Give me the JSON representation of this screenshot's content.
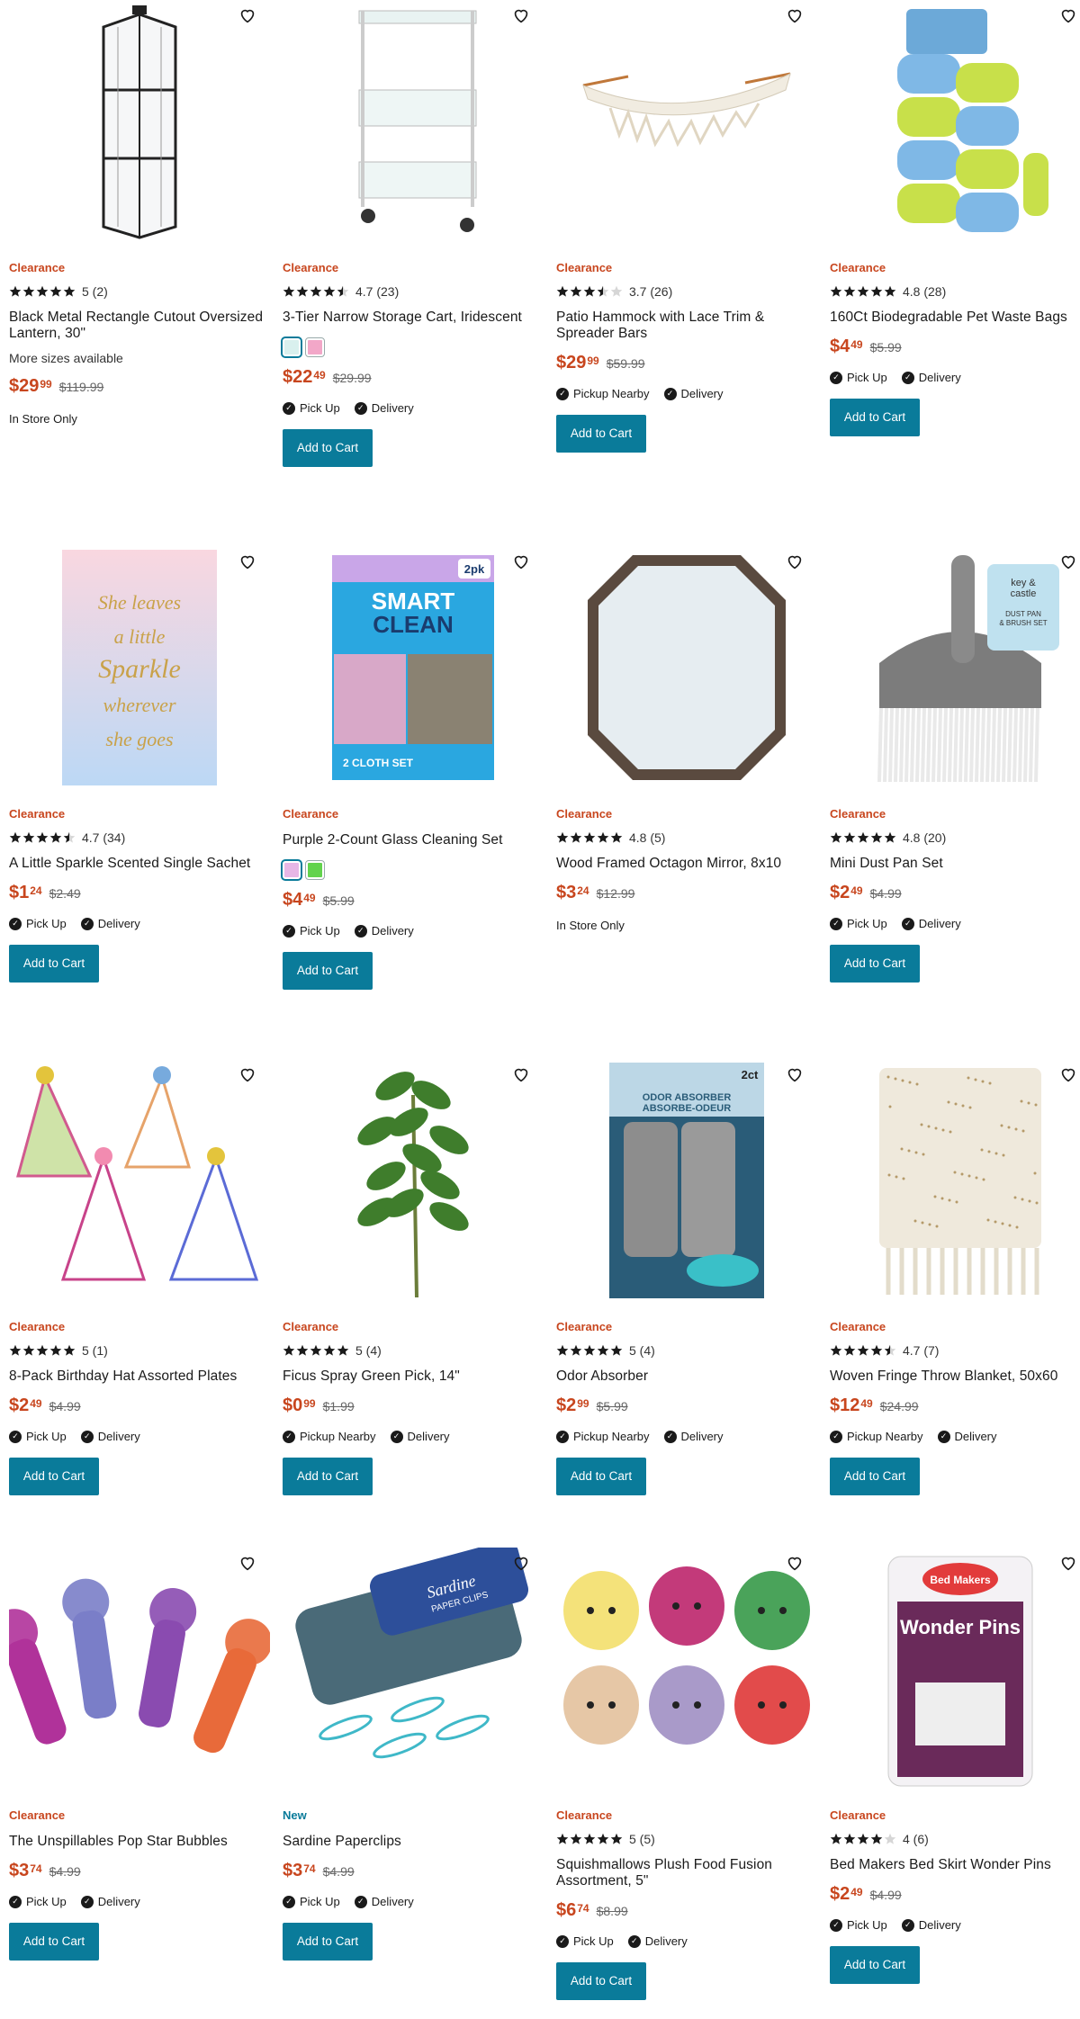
{
  "colors": {
    "clearance": "#c8461e",
    "new": "#0a7b9a",
    "button": "#0a7b9a",
    "text": "#1a1a1a"
  },
  "add_to_cart_label": "Add to Cart",
  "products": [
    {
      "badge": "Clearance",
      "rating": "5 (2)",
      "stars": 5,
      "title": "Black Metal Rectangle Cutout Oversized Lantern, 30\"",
      "more": "More sizes available",
      "price_dollars": "$29",
      "price_cents": "99",
      "was": "$119.99",
      "instore": "In Store Only",
      "image": "lantern"
    },
    {
      "badge": "Clearance",
      "rating": "4.7 (23)",
      "stars": 4.5,
      "title": "3-Tier Narrow Storage Cart, Iridescent",
      "swatches": [
        "#d9f0ee",
        "#f2a7c8"
      ],
      "price_dollars": "$22",
      "price_cents": "49",
      "was": "$29.99",
      "fulfill": [
        "Pick Up",
        "Delivery"
      ],
      "image": "cart"
    },
    {
      "badge": "Clearance",
      "rating": "3.7 (26)",
      "stars": 3.5,
      "title": "Patio Hammock with Lace Trim & Spreader Bars",
      "price_dollars": "$29",
      "price_cents": "99",
      "was": "$59.99",
      "fulfill": [
        "Pickup Nearby",
        "Delivery"
      ],
      "image": "hammock"
    },
    {
      "badge": "Clearance",
      "rating": "4.8 (28)",
      "stars": 5,
      "title": "160Ct Biodegradable Pet Waste Bags",
      "price_dollars": "$4",
      "price_cents": "49",
      "was": "$5.99",
      "fulfill": [
        "Pick Up",
        "Delivery"
      ],
      "image": "bags"
    },
    {
      "badge": "Clearance",
      "rating": "4.7 (34)",
      "stars": 4.5,
      "title": "A Little Sparkle Scented Single Sachet",
      "price_dollars": "$1",
      "price_cents": "24",
      "was": "$2.49",
      "fulfill": [
        "Pick Up",
        "Delivery"
      ],
      "image": "sachet",
      "image_text": [
        "She leaves",
        "a little",
        "Sparkle",
        "wherever",
        "she goes"
      ]
    },
    {
      "badge": "Clearance",
      "title": "Purple 2-Count Glass Cleaning Set",
      "swatches": [
        "#e7b7e6",
        "#62d34d"
      ],
      "price_dollars": "$4",
      "price_cents": "49",
      "was": "$5.99",
      "fulfill": [
        "Pick Up",
        "Delivery"
      ],
      "image": "cloth",
      "image_text": [
        "SMART",
        "CLEAN",
        "2 CLOTH SET",
        "2pk"
      ]
    },
    {
      "badge": "Clearance",
      "rating": "4.8 (5)",
      "stars": 5,
      "title": "Wood Framed Octagon Mirror, 8x10",
      "price_dollars": "$3",
      "price_cents": "24",
      "was": "$12.99",
      "instore": "In Store Only",
      "image": "mirror"
    },
    {
      "badge": "Clearance",
      "rating": "4.8 (20)",
      "stars": 5,
      "title": "Mini Dust Pan Set",
      "price_dollars": "$2",
      "price_cents": "49",
      "was": "$4.99",
      "fulfill": [
        "Pick Up",
        "Delivery"
      ],
      "image": "dustpan",
      "image_text": [
        "key &",
        "castle",
        "DUST PAN",
        "& BRUSH SET"
      ]
    },
    {
      "badge": "Clearance",
      "rating": "5 (1)",
      "stars": 5,
      "title": "8-Pack Birthday Hat Assorted Plates",
      "price_dollars": "$2",
      "price_cents": "49",
      "was": "$4.99",
      "fulfill": [
        "Pick Up",
        "Delivery"
      ],
      "image": "hats"
    },
    {
      "badge": "Clearance",
      "rating": "5 (4)",
      "stars": 5,
      "title": "Ficus Spray Green Pick, 14\"",
      "price_dollars": "$0",
      "price_cents": "99",
      "was": "$1.99",
      "fulfill": [
        "Pickup Nearby",
        "Delivery"
      ],
      "image": "ficus"
    },
    {
      "badge": "Clearance",
      "rating": "5 (4)",
      "stars": 5,
      "title": "Odor Absorber",
      "price_dollars": "$2",
      "price_cents": "99",
      "was": "$5.99",
      "fulfill": [
        "Pickup Nearby",
        "Delivery"
      ],
      "image": "odor",
      "image_text": [
        "ODOR ABSORBER",
        "ABSORBE-ODEUR",
        "2ct"
      ]
    },
    {
      "badge": "Clearance",
      "rating": "4.7 (7)",
      "stars": 4.5,
      "title": "Woven Fringe Throw Blanket, 50x60",
      "price_dollars": "$12",
      "price_cents": "49",
      "was": "$24.99",
      "fulfill": [
        "Pickup Nearby",
        "Delivery"
      ],
      "image": "blanket"
    },
    {
      "badge": "Clearance",
      "title": "The Unspillables Pop Star Bubbles",
      "price_dollars": "$3",
      "price_cents": "74",
      "was": "$4.99",
      "fulfill": [
        "Pick Up",
        "Delivery"
      ],
      "image": "bubbles"
    },
    {
      "badge": "New",
      "title": "Sardine Paperclips",
      "price_dollars": "$3",
      "price_cents": "74",
      "was": "$4.99",
      "fulfill": [
        "Pick Up",
        "Delivery"
      ],
      "image": "paperclips",
      "image_text": [
        "Sardine",
        "PAPER CLIPS"
      ]
    },
    {
      "badge": "Clearance",
      "rating": "5 (5)",
      "stars": 5,
      "title": "Squishmallows Plush Food Fusion Assortment, 5\"",
      "price_dollars": "$6",
      "price_cents": "74",
      "was": "$8.99",
      "fulfill": [
        "Pick Up",
        "Delivery"
      ],
      "image": "plush"
    },
    {
      "badge": "Clearance",
      "rating": "4 (6)",
      "stars": 4,
      "title": "Bed Makers Bed Skirt Wonder Pins",
      "price_dollars": "$2",
      "price_cents": "49",
      "was": "$4.99",
      "fulfill": [
        "Pick Up",
        "Delivery"
      ],
      "image": "pins",
      "image_text": [
        "Bed Makers",
        "Wonder Pins"
      ]
    }
  ]
}
